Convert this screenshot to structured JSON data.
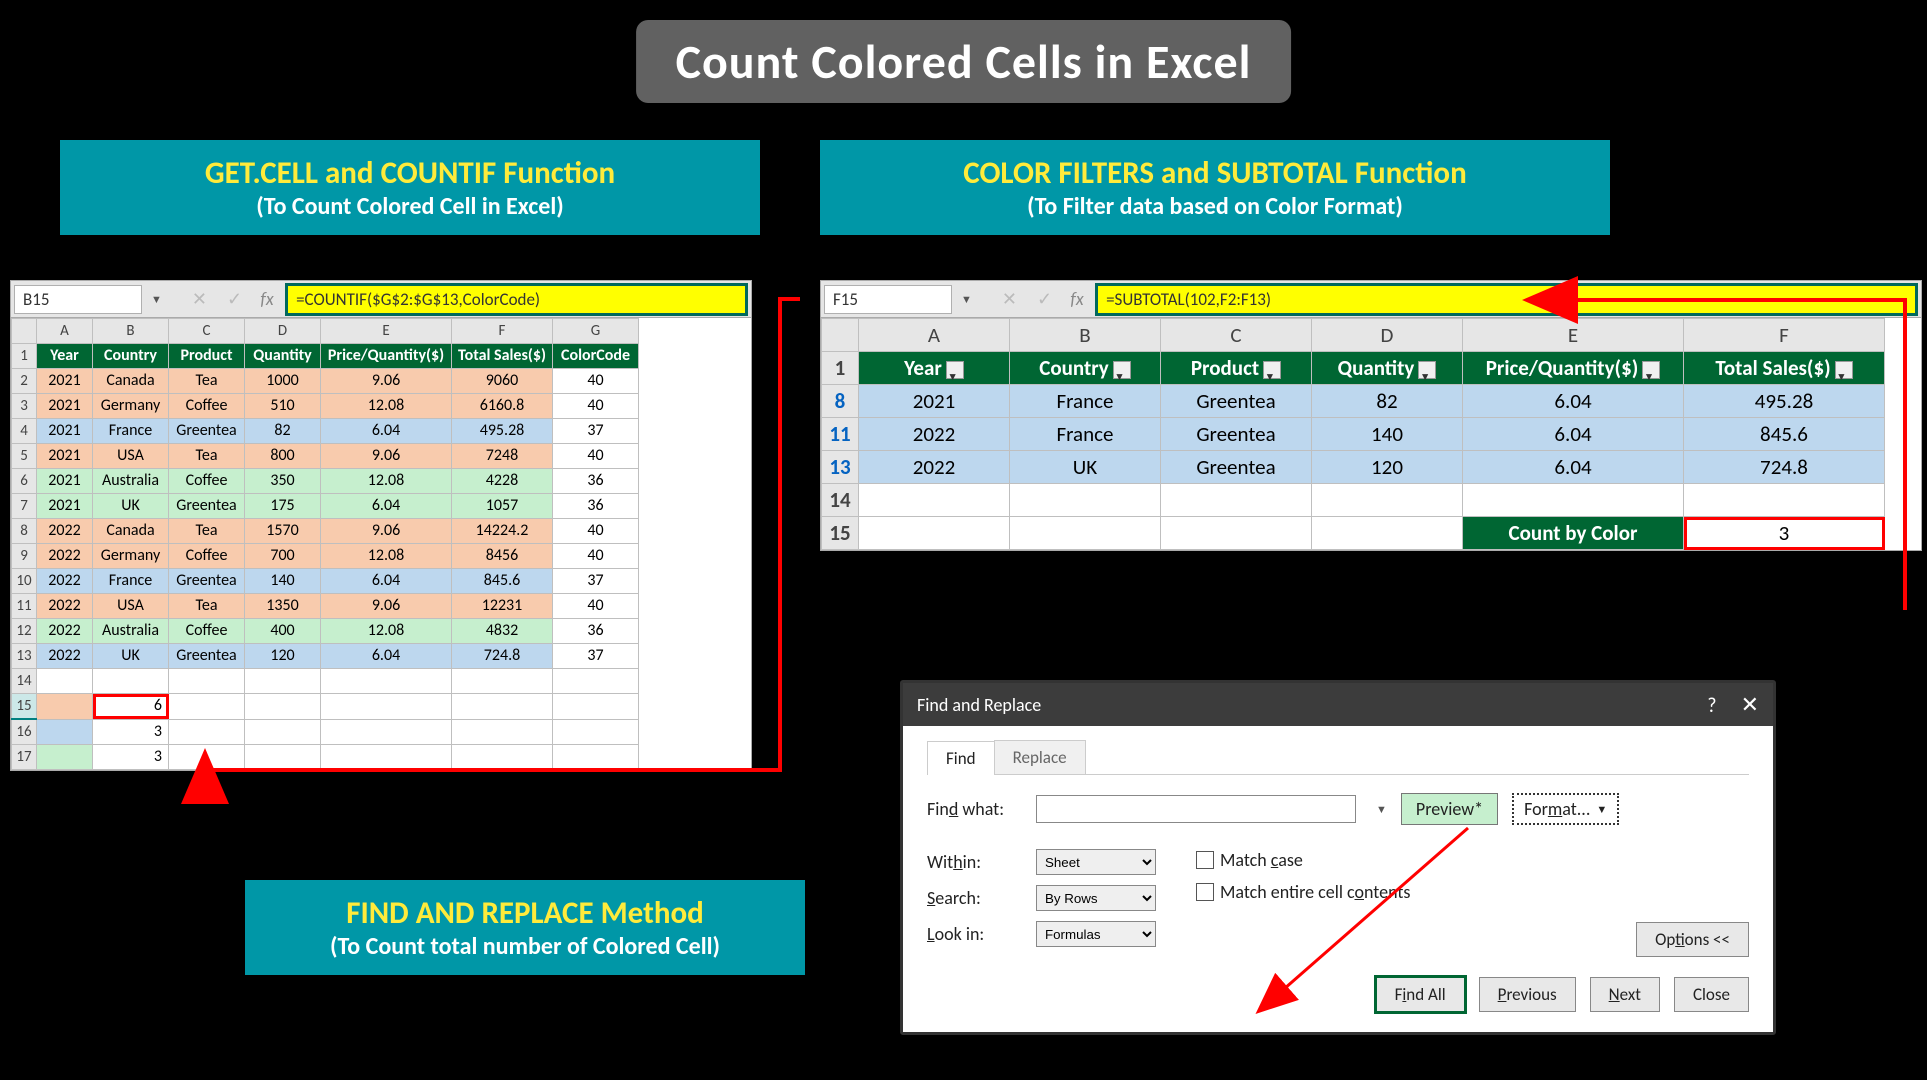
{
  "title": "Count Colored Cells in Excel",
  "banner_left": {
    "line1": "GET.CELL and COUNTIF Function",
    "line2": "(To Count Colored Cell in Excel)"
  },
  "banner_right": {
    "line1": "COLOR FILTERS and SUBTOTAL Function",
    "line2": "(To Filter data based on Color Format)"
  },
  "banner_bottom": {
    "line1": "FIND AND REPLACE Method",
    "line2": "(To Count total number of Colored Cell)"
  },
  "left_panel": {
    "name_box": "B15",
    "formula": "=COUNTIF($G$2:$G$13,ColorCode)",
    "columns": [
      "A",
      "B",
      "C",
      "D",
      "E",
      "F",
      "G"
    ],
    "headers": [
      "Year",
      "Country",
      "Product",
      "Quantity",
      "Price/Quantity($)",
      "Total Sales($)",
      "ColorCode"
    ],
    "rows": [
      {
        "n": 2,
        "c": [
          "2021",
          "Canada",
          "Tea",
          "1000",
          "9.06",
          "9060",
          "40"
        ],
        "cls": "orange"
      },
      {
        "n": 3,
        "c": [
          "2021",
          "Germany",
          "Coffee",
          "510",
          "12.08",
          "6160.8",
          "40"
        ],
        "cls": "orange"
      },
      {
        "n": 4,
        "c": [
          "2021",
          "France",
          "Greentea",
          "82",
          "6.04",
          "495.28",
          "37"
        ],
        "cls": "blue"
      },
      {
        "n": 5,
        "c": [
          "2021",
          "USA",
          "Tea",
          "800",
          "9.06",
          "7248",
          "40"
        ],
        "cls": "orange"
      },
      {
        "n": 6,
        "c": [
          "2021",
          "Australia",
          "Coffee",
          "350",
          "12.08",
          "4228",
          "36"
        ],
        "cls": "green"
      },
      {
        "n": 7,
        "c": [
          "2021",
          "UK",
          "Greentea",
          "175",
          "6.04",
          "1057",
          "36"
        ],
        "cls": "green"
      },
      {
        "n": 8,
        "c": [
          "2022",
          "Canada",
          "Tea",
          "1570",
          "9.06",
          "14224.2",
          "40"
        ],
        "cls": "orange"
      },
      {
        "n": 9,
        "c": [
          "2022",
          "Germany",
          "Coffee",
          "700",
          "12.08",
          "8456",
          "40"
        ],
        "cls": "orange"
      },
      {
        "n": 10,
        "c": [
          "2022",
          "France",
          "Greentea",
          "140",
          "6.04",
          "845.6",
          "37"
        ],
        "cls": "blue"
      },
      {
        "n": 11,
        "c": [
          "2022",
          "USA",
          "Tea",
          "1350",
          "9.06",
          "12231",
          "40"
        ],
        "cls": "orange"
      },
      {
        "n": 12,
        "c": [
          "2022",
          "Australia",
          "Coffee",
          "400",
          "12.08",
          "4832",
          "36"
        ],
        "cls": "green"
      },
      {
        "n": 13,
        "c": [
          "2022",
          "UK",
          "Greentea",
          "120",
          "6.04",
          "724.8",
          "37"
        ],
        "cls": "blue"
      }
    ],
    "result_rows": [
      {
        "n": 15,
        "a_cls": "orange",
        "b": "6",
        "highlight": true
      },
      {
        "n": 16,
        "a_cls": "blue",
        "b": "3"
      },
      {
        "n": 17,
        "a_cls": "green",
        "b": "3"
      }
    ],
    "blank_row": 14
  },
  "right_panel": {
    "name_box": "F15",
    "formula": "=SUBTOTAL(102,F2:F13)",
    "columns": [
      "A",
      "B",
      "C",
      "D",
      "E",
      "F"
    ],
    "headers": [
      "Year",
      "Country",
      "Product",
      "Quantity",
      "Price/Quantity($)",
      "Total Sales($)"
    ],
    "rows": [
      {
        "n": 8,
        "c": [
          "2021",
          "France",
          "Greentea",
          "82",
          "6.04",
          "495.28"
        ]
      },
      {
        "n": 11,
        "c": [
          "2022",
          "France",
          "Greentea",
          "140",
          "6.04",
          "845.6"
        ]
      },
      {
        "n": 13,
        "c": [
          "2022",
          "UK",
          "Greentea",
          "120",
          "6.04",
          "724.8"
        ]
      }
    ],
    "summary": {
      "label": "Count by Color",
      "value": "3",
      "row": 15
    },
    "blank_row": 14
  },
  "dialog": {
    "title": "Find and Replace",
    "tab_find": "Find",
    "tab_replace": "Replace",
    "find_what_label": "Find what:",
    "preview": "Preview*",
    "format": "Format...",
    "within_label": "Within:",
    "within_value": "Sheet",
    "search_label": "Search:",
    "search_value": "By Rows",
    "lookin_label": "Look in:",
    "lookin_value": "Formulas",
    "match_case": "Match case",
    "match_contents": "Match entire cell contents",
    "options": "Options <<",
    "find_all": "Find All",
    "find_next": "Next",
    "previous": "Previous",
    "close": "Close"
  }
}
